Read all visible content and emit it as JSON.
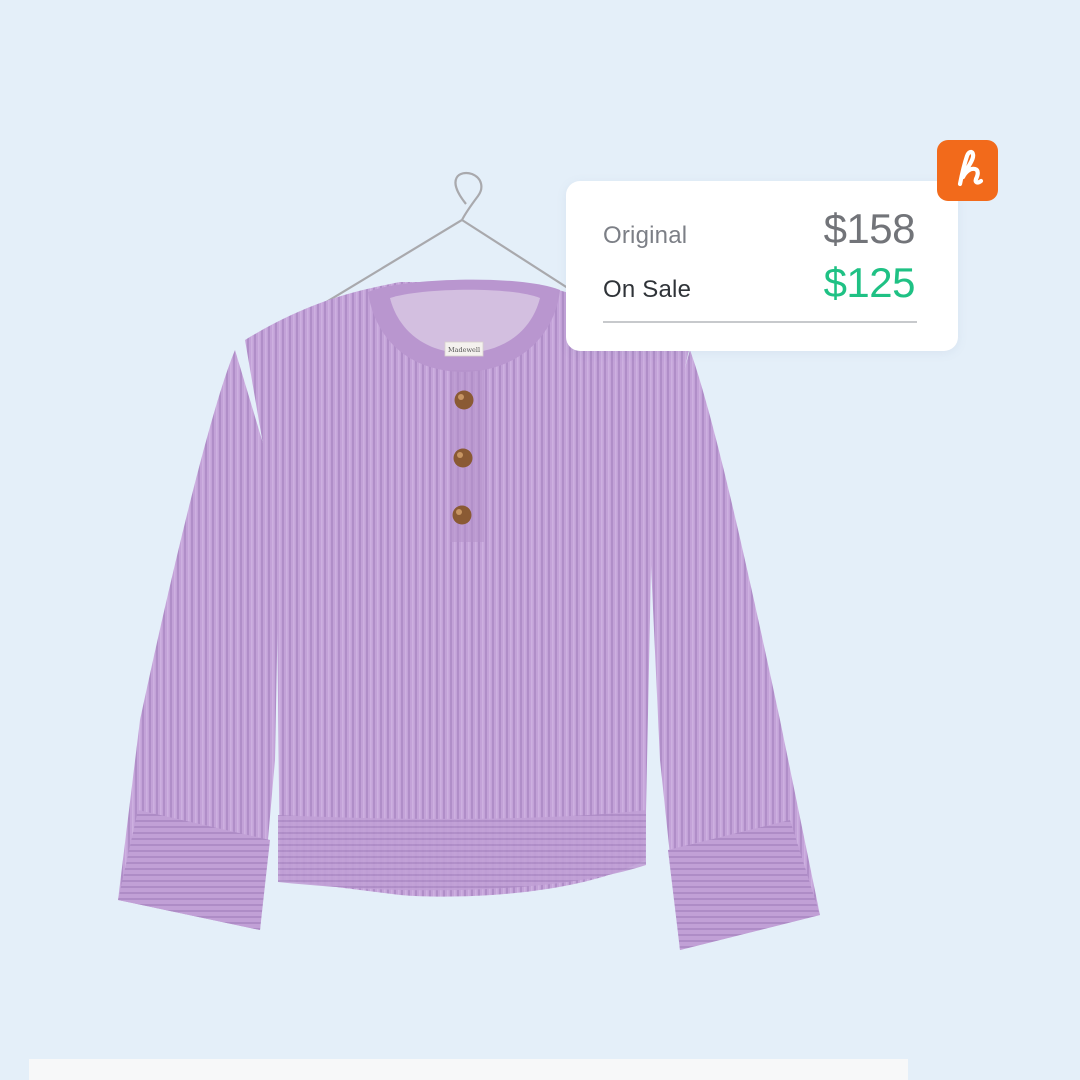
{
  "product": {
    "image_alt": "Lilac ribbed knit henley sweater on a hanger",
    "garment_color": "#c09ed5",
    "button_color": "#8a5a34"
  },
  "price_card": {
    "original_label": "Original",
    "original_price": "$158",
    "sale_label": "On Sale",
    "sale_price": "$125"
  },
  "brand": {
    "icon": "honey-logo-icon",
    "color": "#f26a1b"
  },
  "colors": {
    "background": "#e4eff9",
    "sale_price": "#1fc184",
    "original_price": "#727479"
  }
}
